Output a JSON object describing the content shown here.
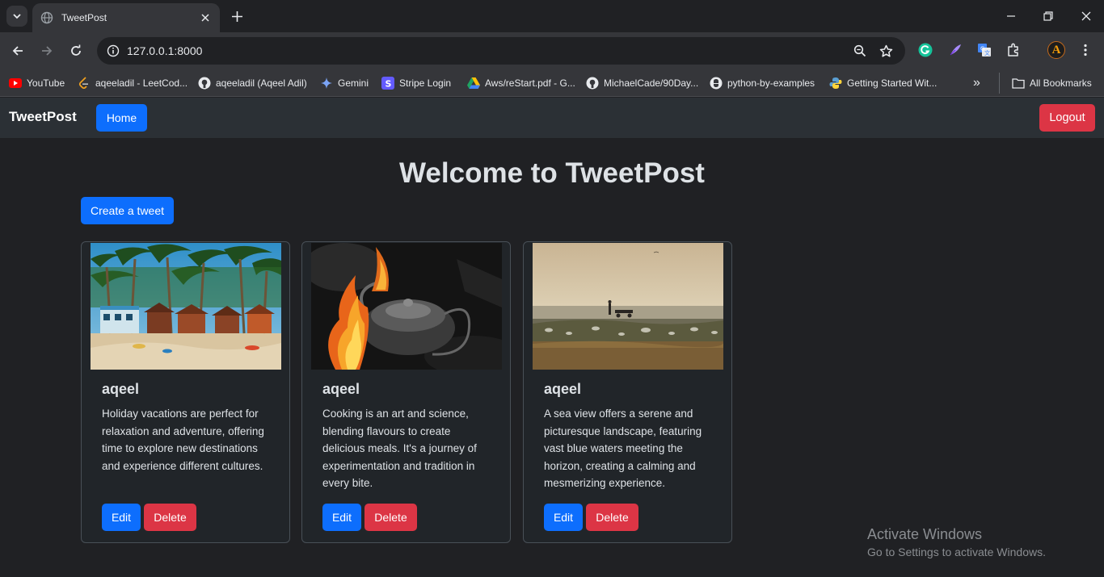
{
  "browser": {
    "tab_title": "TweetPost",
    "url": "127.0.0.1:8000",
    "bookmarks": [
      {
        "label": "YouTube",
        "icon": "youtube-icon"
      },
      {
        "label": "aqeeladil - LeetCod...",
        "icon": "leetcode-icon"
      },
      {
        "label": "aqeeladil (Aqeel Adil)",
        "icon": "github-icon"
      },
      {
        "label": "Gemini",
        "icon": "gemini-icon"
      },
      {
        "label": "Stripe Login",
        "icon": "stripe-icon"
      },
      {
        "label": "Aws/reStart.pdf - G...",
        "icon": "google-drive-icon"
      },
      {
        "label": "MichaelCade/90Day...",
        "icon": "github-icon"
      },
      {
        "label": "python-by-examples",
        "icon": "python-icon"
      },
      {
        "label": "Getting Started Wit...",
        "icon": "python-icon"
      }
    ],
    "more_bookmarks": "»",
    "all_bookmarks": "All Bookmarks",
    "profile_initial": "A"
  },
  "navbar": {
    "brand": "TweetPost",
    "home_label": "Home",
    "logout_label": "Logout"
  },
  "main": {
    "title": "Welcome to TweetPost",
    "create_label": "Create a tweet"
  },
  "tweets": [
    {
      "user": "aqeel",
      "text": "Holiday vacations are perfect for relaxation and adventure, offering time to explore new destinations and experience different cultures.",
      "image": "beach-with-palm-trees",
      "edit_label": "Edit",
      "delete_label": "Delete"
    },
    {
      "user": "aqeel",
      "text": "Cooking is an art and science, blending flavours to create delicious meals. It's a journey of experimentation and tradition in every bite.",
      "image": "kettle-over-fire",
      "edit_label": "Edit",
      "delete_label": "Delete"
    },
    {
      "user": "aqeel",
      "text": "A sea view offers a serene and picturesque landscape, featuring vast blue waters meeting the horizon, creating a calming and mesmerizing experience.",
      "image": "sea-view-with-person",
      "edit_label": "Edit",
      "delete_label": "Delete"
    }
  ],
  "watermark": {
    "line1": "Activate Windows",
    "line2": "Go to Settings to activate Windows."
  },
  "colors": {
    "primary": "#0d6efd",
    "danger": "#dc3545",
    "page_bg": "#212529",
    "navbar_bg": "#2b3035"
  }
}
